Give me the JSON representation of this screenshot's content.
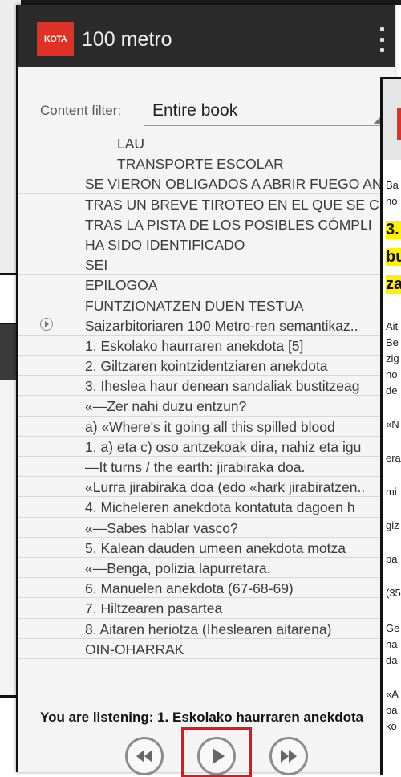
{
  "app": {
    "logo_text": "KOTA",
    "title": "100 metro"
  },
  "filter": {
    "label": "Content filter:",
    "value": "Entire book"
  },
  "toc": [
    {
      "text": "LAU",
      "indent": 2
    },
    {
      "text": "TRANSPORTE ESCOLAR",
      "indent": 2
    },
    {
      "text": "SE VIERON OBLIGADOS A ABRIR FUEGO AN",
      "indent": 1
    },
    {
      "text": "TRAS UN BREVE TIROTEO EN EL QUE SE C",
      "indent": 1
    },
    {
      "text": "TRAS LA PISTA DE LOS POSIBLES CÓMPLI",
      "indent": 1
    },
    {
      "text": "HA SIDO IDENTIFICADO",
      "indent": 1
    },
    {
      "text": "SEI",
      "indent": 1
    },
    {
      "text": "EPILOGOA",
      "indent": 1
    },
    {
      "text": "FUNTZIONATZEN DUEN TESTUA",
      "indent": 1
    },
    {
      "text": "Saizarbitoriaren 100 Metro-ren semantikaz..",
      "indent": 1,
      "playable": true
    },
    {
      "text": "1. Eskolako haurraren anekdota [5]",
      "indent": 1
    },
    {
      "text": "2. Giltzaren kointzidentziaren anekdota",
      "indent": 1
    },
    {
      "text": "3. Iheslea haur denean sandaliak bustitzeag",
      "indent": 1
    },
    {
      "text": "«—Zer nahi duzu entzun?",
      "indent": 1
    },
    {
      "text": "a) «Where's it going all this spilled blood",
      "indent": 1
    },
    {
      "text": "1. a) eta c) oso antzekoak dira, nahiz eta igu",
      "indent": 1
    },
    {
      "text": "—It turns / the earth: jirabiraka doa.",
      "indent": 1
    },
    {
      "text": "«Lurra jirabiraka doa (edo «hark jirabiratzen..",
      "indent": 1
    },
    {
      "text": "4. Micheleren anekdota kontatuta dagoen h",
      "indent": 1
    },
    {
      "text": "«—Sabes hablar vasco?",
      "indent": 1
    },
    {
      "text": "5. Kalean dauden umeen anekdota motza",
      "indent": 1
    },
    {
      "text": "«—Benga, polizia lapurretara.",
      "indent": 1
    },
    {
      "text": "6. Manuelen anekdota (67-68-69)",
      "indent": 1
    },
    {
      "text": "7. Hiltzearen pasartea",
      "indent": 1
    },
    {
      "text": "8. Aitaren heriotza (Iheslearen aitarena)",
      "indent": 1
    },
    {
      "text": "OIN-OHARRAK",
      "indent": 1
    }
  ],
  "status": {
    "text": "You are listening: 1. Eskolako haurraren anekdota"
  },
  "controls": {
    "rewind_icon": "rewind-icon",
    "play_icon": "play-icon",
    "forward_icon": "fast-forward-icon",
    "highlight_color": "#e5141b"
  },
  "reader_fragments": {
    "line1": "Ba",
    "line2": "ho",
    "heading1": "3.",
    "heading2": "bu",
    "heading3": "za",
    "p1": "Ait",
    "p2": "Be",
    "p3": "zig",
    "p4": "no",
    "p5": "de",
    "p6": "«N",
    "p7": "era",
    "p8": "mi",
    "p9": "giz",
    "p10": "pa",
    "p11": "(35",
    "p12": "Ge",
    "p13": "ha",
    "p14": "da",
    "p15": "«A",
    "p16": "ba",
    "p17": "ko"
  }
}
